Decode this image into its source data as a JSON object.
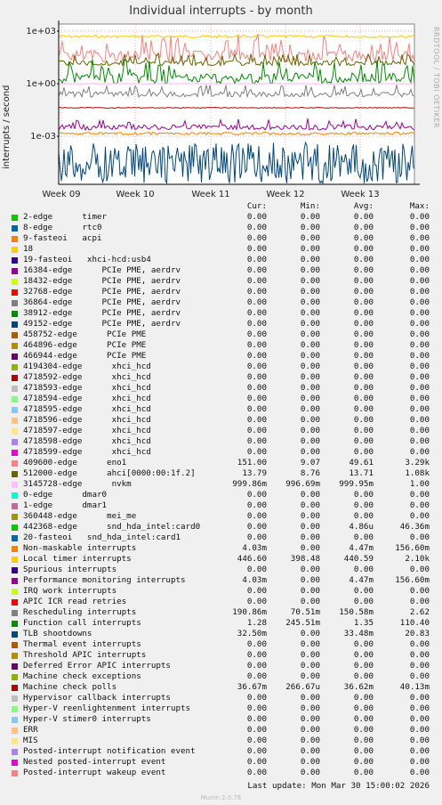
{
  "title": "Individual interrupts - by month",
  "side_label": "RRDTOOL / TOBI OETIKER",
  "footer": "Last update: Mon Mar 30 15:00:02 2026",
  "munin_version": "Munin 2.0.76",
  "chart_data": {
    "type": "line",
    "title": "Individual interrupts - by month",
    "ylabel": "interrupts / second",
    "yscale": "log",
    "yticks": [
      "1e+03",
      "1e+00",
      "1e-03"
    ],
    "xticks": [
      "Week 09",
      "Week 10",
      "Week 11",
      "Week 12",
      "Week 13"
    ],
    "columns": [
      "Cur:",
      "Min:",
      "Avg:",
      "Max:"
    ],
    "series": [
      {
        "name": "2-edge      timer",
        "color": "#00cc00",
        "values": [
          "0.00",
          "0.00",
          "0.00",
          "0.00"
        ]
      },
      {
        "name": "8-edge      rtc0",
        "color": "#0066b3",
        "values": [
          "0.00",
          "0.00",
          "0.00",
          "0.00"
        ]
      },
      {
        "name": "9-fasteoi   acpi",
        "color": "#ff8000",
        "values": [
          "0.00",
          "0.00",
          "0.00",
          "0.00"
        ]
      },
      {
        "name": "18",
        "color": "#ffcc00",
        "values": [
          "0.00",
          "0.00",
          "0.00",
          "0.00"
        ]
      },
      {
        "name": "19-fasteoi   xhci-hcd:usb4",
        "color": "#330099",
        "values": [
          "0.00",
          "0.00",
          "0.00",
          "0.00"
        ]
      },
      {
        "name": "16384-edge      PCIe PME, aerdrv",
        "color": "#990099",
        "values": [
          "0.00",
          "0.00",
          "0.00",
          "0.00"
        ]
      },
      {
        "name": "18432-edge      PCIe PME, aerdrv",
        "color": "#ccff00",
        "values": [
          "0.00",
          "0.00",
          "0.00",
          "0.00"
        ]
      },
      {
        "name": "32768-edge      PCIe PME, aerdrv",
        "color": "#ff0000",
        "values": [
          "0.00",
          "0.00",
          "0.00",
          "0.00"
        ]
      },
      {
        "name": "36864-edge      PCIe PME, aerdrv",
        "color": "#808080",
        "values": [
          "0.00",
          "0.00",
          "0.00",
          "0.00"
        ]
      },
      {
        "name": "38912-edge      PCIe PME, aerdrv",
        "color": "#008f00",
        "values": [
          "0.00",
          "0.00",
          "0.00",
          "0.00"
        ]
      },
      {
        "name": "49152-edge      PCIe PME, aerdrv",
        "color": "#00487d",
        "values": [
          "0.00",
          "0.00",
          "0.00",
          "0.00"
        ]
      },
      {
        "name": "458752-edge      PCIe PME",
        "color": "#b35a00",
        "values": [
          "0.00",
          "0.00",
          "0.00",
          "0.00"
        ]
      },
      {
        "name": "464896-edge      PCIe PME",
        "color": "#b38f00",
        "values": [
          "0.00",
          "0.00",
          "0.00",
          "0.00"
        ]
      },
      {
        "name": "466944-edge      PCIe PME",
        "color": "#6b006b",
        "values": [
          "0.00",
          "0.00",
          "0.00",
          "0.00"
        ]
      },
      {
        "name": "4194304-edge      xhci_hcd",
        "color": "#8fb300",
        "values": [
          "0.00",
          "0.00",
          "0.00",
          "0.00"
        ]
      },
      {
        "name": "4718592-edge      xhci_hcd",
        "color": "#b30000",
        "values": [
          "0.00",
          "0.00",
          "0.00",
          "0.00"
        ]
      },
      {
        "name": "4718593-edge      xhci_hcd",
        "color": "#bebebe",
        "values": [
          "0.00",
          "0.00",
          "0.00",
          "0.00"
        ]
      },
      {
        "name": "4718594-edge      xhci_hcd",
        "color": "#80ff80",
        "values": [
          "0.00",
          "0.00",
          "0.00",
          "0.00"
        ]
      },
      {
        "name": "4718595-edge      xhci_hcd",
        "color": "#80c9ff",
        "values": [
          "0.00",
          "0.00",
          "0.00",
          "0.00"
        ]
      },
      {
        "name": "4718596-edge      xhci_hcd",
        "color": "#ffc080",
        "values": [
          "0.00",
          "0.00",
          "0.00",
          "0.00"
        ]
      },
      {
        "name": "4718597-edge      xhci_hcd",
        "color": "#ffe680",
        "values": [
          "0.00",
          "0.00",
          "0.00",
          "0.00"
        ]
      },
      {
        "name": "4718598-edge      xhci_hcd",
        "color": "#aa80ff",
        "values": [
          "0.00",
          "0.00",
          "0.00",
          "0.00"
        ]
      },
      {
        "name": "4718599-edge      xhci_hcd",
        "color": "#ee00cc",
        "values": [
          "0.00",
          "0.00",
          "0.00",
          "0.00"
        ]
      },
      {
        "name": "409600-edge      eno1",
        "color": "#ff8080",
        "values": [
          "151.00",
          "9.07",
          "49.61",
          "3.29k"
        ]
      },
      {
        "name": "512000-edge      ahci[0000:00:1f.2]",
        "color": "#666600",
        "values": [
          "13.79",
          "8.76",
          "13.71",
          "1.08k"
        ]
      },
      {
        "name": "3145728-edge      nvkm",
        "color": "#ffbfff",
        "values": [
          "999.86m",
          "996.69m",
          "999.95m",
          "1.00"
        ]
      },
      {
        "name": "0-edge      dmar0",
        "color": "#00ffcc",
        "values": [
          "0.00",
          "0.00",
          "0.00",
          "0.00"
        ]
      },
      {
        "name": "1-edge      dmar1",
        "color": "#cc6699",
        "values": [
          "0.00",
          "0.00",
          "0.00",
          "0.00"
        ]
      },
      {
        "name": "360448-edge      mei_me",
        "color": "#999900",
        "values": [
          "0.00",
          "0.00",
          "0.00",
          "0.00"
        ]
      },
      {
        "name": "442368-edge      snd_hda_intel:card0",
        "color": "#00cc00",
        "values": [
          "0.00",
          "0.00",
          "4.86u",
          "46.36m"
        ]
      },
      {
        "name": "20-fasteoi   snd_hda_intel:card1",
        "color": "#0066b3",
        "values": [
          "0.00",
          "0.00",
          "0.00",
          "0.00"
        ]
      },
      {
        "name": "Non-maskable interrupts",
        "color": "#ff8000",
        "values": [
          "4.03m",
          "0.00",
          "4.47m",
          "156.60m"
        ]
      },
      {
        "name": "Local timer interrupts",
        "color": "#ffcc00",
        "values": [
          "446.60",
          "398.48",
          "440.59",
          "2.10k"
        ]
      },
      {
        "name": "Spurious interrupts",
        "color": "#330099",
        "values": [
          "0.00",
          "0.00",
          "0.00",
          "0.00"
        ]
      },
      {
        "name": "Performance monitoring interrupts",
        "color": "#990099",
        "values": [
          "4.03m",
          "0.00",
          "4.47m",
          "156.60m"
        ]
      },
      {
        "name": "IRQ work interrupts",
        "color": "#ccff00",
        "values": [
          "0.00",
          "0.00",
          "0.00",
          "0.00"
        ]
      },
      {
        "name": "APIC ICR read retries",
        "color": "#ff0000",
        "values": [
          "0.00",
          "0.00",
          "0.00",
          "0.00"
        ]
      },
      {
        "name": "Rescheduling interrupts",
        "color": "#808080",
        "values": [
          "190.86m",
          "70.51m",
          "150.58m",
          "2.62"
        ]
      },
      {
        "name": "Function call interrupts",
        "color": "#008f00",
        "values": [
          "1.28",
          "245.51m",
          "1.35",
          "110.40"
        ]
      },
      {
        "name": "TLB shootdowns",
        "color": "#00487d",
        "values": [
          "32.50m",
          "0.00",
          "33.48m",
          "20.83"
        ]
      },
      {
        "name": "Thermal event interrupts",
        "color": "#b35a00",
        "values": [
          "0.00",
          "0.00",
          "0.00",
          "0.00"
        ]
      },
      {
        "name": "Threshold APIC interrupts",
        "color": "#b38f00",
        "values": [
          "0.00",
          "0.00",
          "0.00",
          "0.00"
        ]
      },
      {
        "name": "Deferred Error APIC interrupts",
        "color": "#6b006b",
        "values": [
          "0.00",
          "0.00",
          "0.00",
          "0.00"
        ]
      },
      {
        "name": "Machine check exceptions",
        "color": "#8fb300",
        "values": [
          "0.00",
          "0.00",
          "0.00",
          "0.00"
        ]
      },
      {
        "name": "Machine check polls",
        "color": "#b30000",
        "values": [
          "36.67m",
          "266.67u",
          "36.62m",
          "40.13m"
        ]
      },
      {
        "name": "Hypervisor callback interrupts",
        "color": "#bebebe",
        "values": [
          "0.00",
          "0.00",
          "0.00",
          "0.00"
        ]
      },
      {
        "name": "Hyper-V reenlightenment interrupts",
        "color": "#80ff80",
        "values": [
          "0.00",
          "0.00",
          "0.00",
          "0.00"
        ]
      },
      {
        "name": "Hyper-V stimer0 interrupts",
        "color": "#80c9ff",
        "values": [
          "0.00",
          "0.00",
          "0.00",
          "0.00"
        ]
      },
      {
        "name": "ERR",
        "color": "#ffc080",
        "values": [
          "0.00",
          "0.00",
          "0.00",
          "0.00"
        ]
      },
      {
        "name": "MIS",
        "color": "#ffe680",
        "values": [
          "0.00",
          "0.00",
          "0.00",
          "0.00"
        ]
      },
      {
        "name": "Posted-interrupt notification event",
        "color": "#aa80ff",
        "values": [
          "0.00",
          "0.00",
          "0.00",
          "0.00"
        ]
      },
      {
        "name": "Nested posted-interrupt event",
        "color": "#ee00cc",
        "values": [
          "0.00",
          "0.00",
          "0.00",
          "0.00"
        ]
      },
      {
        "name": "Posted-interrupt wakeup event",
        "color": "#ff8080",
        "values": [
          "0.00",
          "0.00",
          "0.00",
          "0.00"
        ]
      }
    ]
  }
}
